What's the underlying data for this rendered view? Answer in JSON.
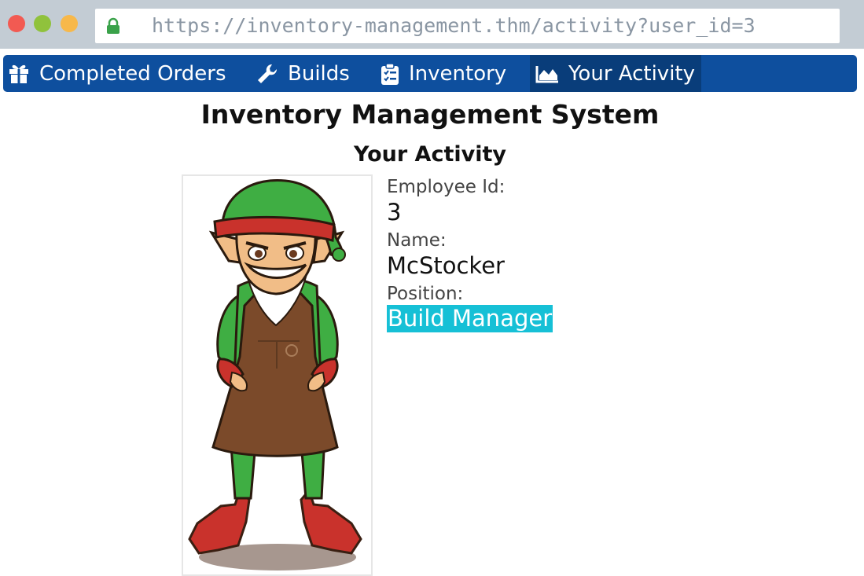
{
  "browser": {
    "url": "https://inventory-management.thm/activity?user_id=3"
  },
  "nav": {
    "items": [
      {
        "label": "Completed Orders",
        "icon": "gift-icon"
      },
      {
        "label": "Builds",
        "icon": "wrench-icon"
      },
      {
        "label": "Inventory",
        "icon": "clipboard-list-icon"
      },
      {
        "label": "Your Activity",
        "icon": "chart-area-icon",
        "active": true
      }
    ]
  },
  "page": {
    "title": "Inventory Management System",
    "subtitle": "Your Activity"
  },
  "employee": {
    "id_label": "Employee Id:",
    "id": "3",
    "name_label": "Name:",
    "name": "McStocker",
    "position_label": "Position:",
    "position": "Build Manager",
    "photo": "elf-character-image"
  },
  "colors": {
    "nav_bg": "#0e4f9e",
    "nav_active": "#093d7a",
    "highlight": "#16c0d6"
  }
}
